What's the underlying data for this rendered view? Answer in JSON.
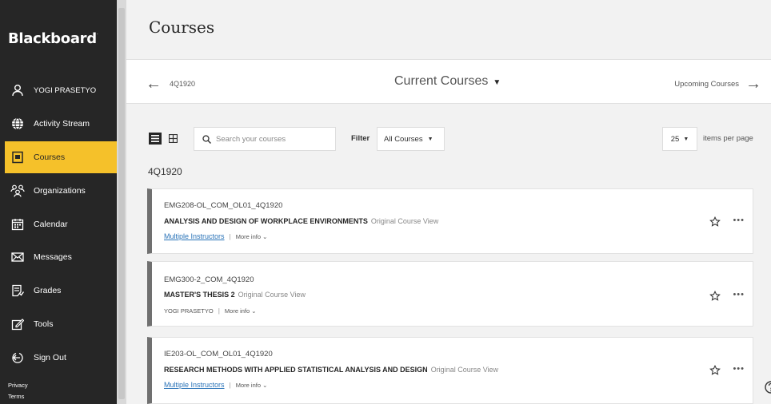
{
  "sidebar": {
    "logo": "Blackboard",
    "items": [
      {
        "label": "YOGI PRASETYO",
        "icon": "user-icon"
      },
      {
        "label": "Activity Stream",
        "icon": "globe-icon"
      },
      {
        "label": "Courses",
        "icon": "courses-icon"
      },
      {
        "label": "Organizations",
        "icon": "organizations-icon"
      },
      {
        "label": "Calendar",
        "icon": "calendar-icon"
      },
      {
        "label": "Messages",
        "icon": "envelope-icon"
      },
      {
        "label": "Grades",
        "icon": "grades-icon"
      },
      {
        "label": "Tools",
        "icon": "tools-icon"
      },
      {
        "label": "Sign Out",
        "icon": "sign-out-icon"
      }
    ],
    "active_item": "Courses",
    "footer": {
      "privacy": "Privacy",
      "terms": "Terms"
    }
  },
  "page": {
    "title": "Courses"
  },
  "term_bar": {
    "previous_term": "4Q1920",
    "current_label": "Current Courses",
    "next_label": "Upcoming Courses"
  },
  "toolbar": {
    "search_placeholder": "Search your courses",
    "filter_label": "Filter",
    "filter_value": "All Courses",
    "per_page_value": "25",
    "per_page_label": "items per page"
  },
  "term_heading": "4Q1920",
  "courses": [
    {
      "id": "EMG208-OL_COM_OL01_4Q1920",
      "title": "ANALYSIS AND DESIGN OF WORKPLACE ENVIRONMENTS",
      "view": "Original Course View",
      "instructors": "Multiple Instructors",
      "more_info": "More info"
    },
    {
      "id": "EMG300-2_COM_4Q1920",
      "title": "MASTER'S THESIS 2",
      "view": "Original Course View",
      "instructors": "YOGI PRASETYO",
      "more_info": "More info"
    },
    {
      "id": "IE203-OL_COM_OL01_4Q1920",
      "title": "RESEARCH METHODS WITH APPLIED STATISTICAL ANALYSIS AND DESIGN",
      "view": "Original Course View",
      "instructors": "Multiple Instructors",
      "more_info": "More info"
    }
  ],
  "colors": {
    "sidebar_bg": "#262626",
    "active_item": "#f5c12a",
    "link": "#2a73b8"
  }
}
